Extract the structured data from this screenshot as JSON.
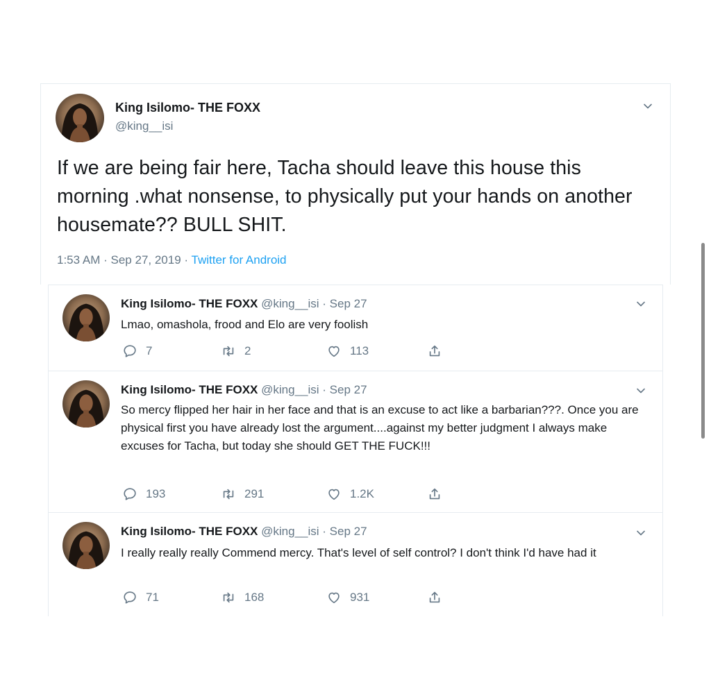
{
  "main_tweet": {
    "display_name": "King Isilomo- THE FOXX",
    "handle": "@king__isi",
    "text": "If we are being fair here, Tacha should  leave this house this morning .what nonsense, to physically put your hands on another housemate?? BULL SHIT.",
    "time": "1:53 AM",
    "date": "Sep 27, 2019",
    "separator": "·",
    "source": "Twitter for Android"
  },
  "replies": [
    {
      "display_name": "King Isilomo- THE FOXX",
      "meta": "@king__isi · Sep 27",
      "text": "Lmao, omashola, frood and Elo are very foolish",
      "replies": "7",
      "retweets": "2",
      "likes": "113"
    },
    {
      "display_name": "King Isilomo- THE FOXX",
      "meta": "@king__isi · Sep 27",
      "text": "So mercy flipped her hair in her face and that  is an excuse to act like a barbarian???. Once you are physical first you have already lost the argument....against my better judgment I always make excuses for Tacha, but today she should GET THE FUCK!!!",
      "replies": "193",
      "retweets": "291",
      "likes": "1.2K"
    },
    {
      "display_name": "King Isilomo- THE FOXX",
      "meta": "@king__isi · Sep 27",
      "text": "I really really really Commend mercy. That's level of self control? I don't think I'd have had it",
      "replies": "71",
      "retweets": "168",
      "likes": "931"
    }
  ],
  "icons": {
    "reply": "reply-icon",
    "retweet": "retweet-icon",
    "like": "heart-icon",
    "share": "share-icon",
    "caret": "chevron-down-icon"
  },
  "colors": {
    "text": "#14171a",
    "secondary": "#657786",
    "link": "#1da1f2",
    "border": "#e6ecf0"
  }
}
